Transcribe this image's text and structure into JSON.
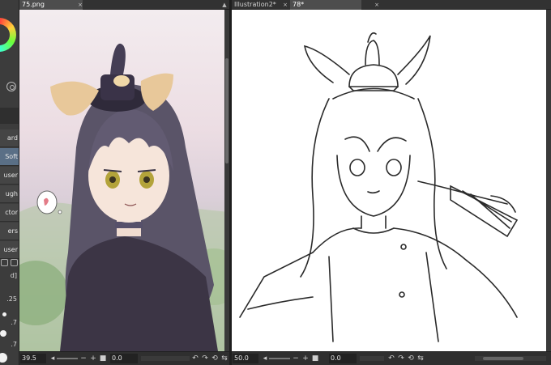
{
  "left_panel": {
    "brushes": [
      "ard",
      "Soft",
      "user",
      "ugh",
      "ctor",
      "ers",
      "user"
    ],
    "field_label": "d]",
    "brush_sizes": [
      ".25",
      ".7",
      ".7"
    ],
    "icons": [
      "color-wheel-icon",
      "wheel-settings-icon",
      "new-brush-icon",
      "delete-brush-icon"
    ]
  },
  "canvases": [
    {
      "tab_label": "75.png",
      "zoom": "39.5",
      "angle": "0.0",
      "artwork_description": "colored-illustration"
    },
    {
      "tabs": [
        {
          "label": "Illustration2*",
          "active": false
        },
        {
          "label": "78*",
          "active": true
        }
      ],
      "zoom": "50.0",
      "angle": "0.0",
      "artwork_description": "line-sketch"
    }
  ],
  "colors": {
    "accent_active_brush": "#5a6f86",
    "panel_bg": "#3c3c3c",
    "tab_bar_bg": "#323232"
  }
}
